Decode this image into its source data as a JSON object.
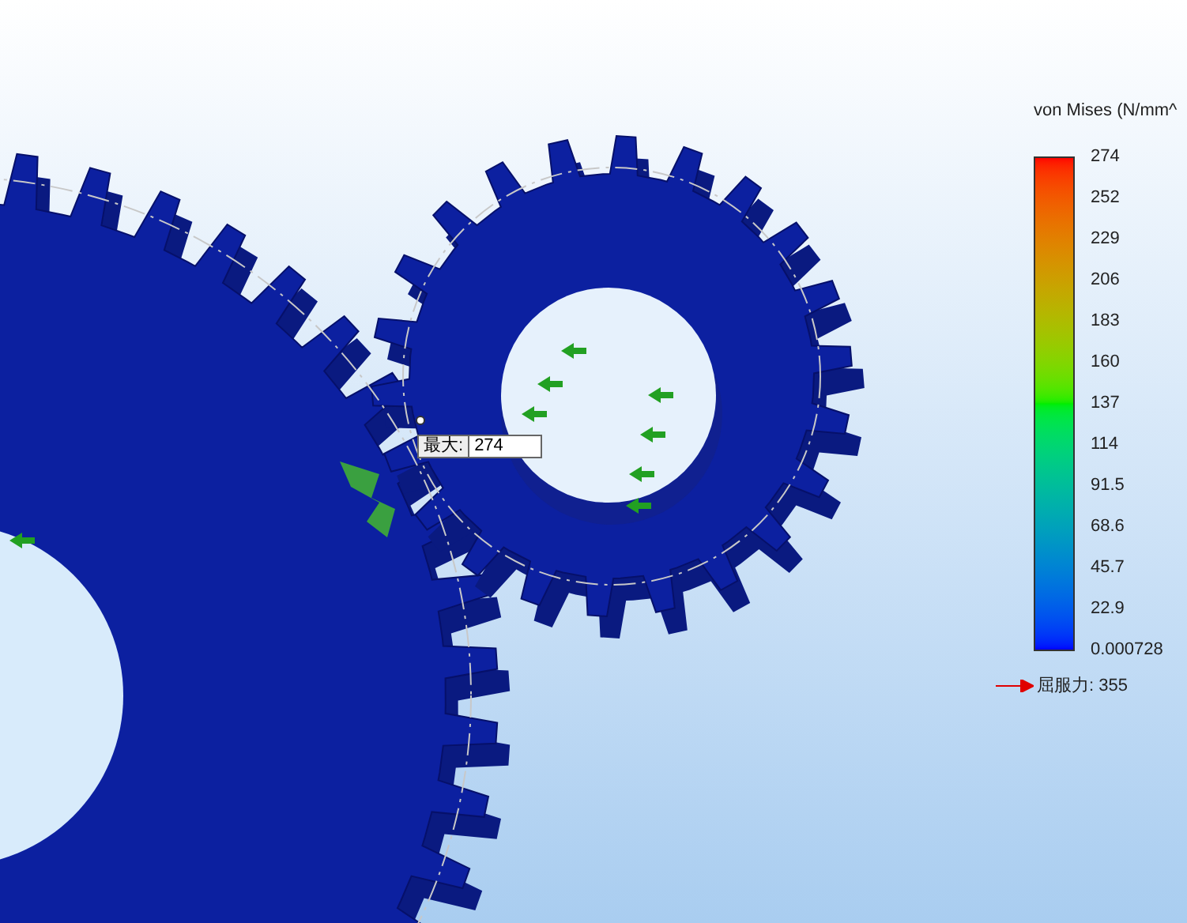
{
  "legend": {
    "title": "von Mises (N/mm^",
    "ticks": [
      "274",
      "252",
      "229",
      "206",
      "183",
      "160",
      "137",
      "114",
      "91.5",
      "68.6",
      "45.7",
      "22.9",
      "0.000728"
    ],
    "yield_label": "屈服力: 355"
  },
  "max_probe": {
    "label": "最大:",
    "value": "274"
  }
}
